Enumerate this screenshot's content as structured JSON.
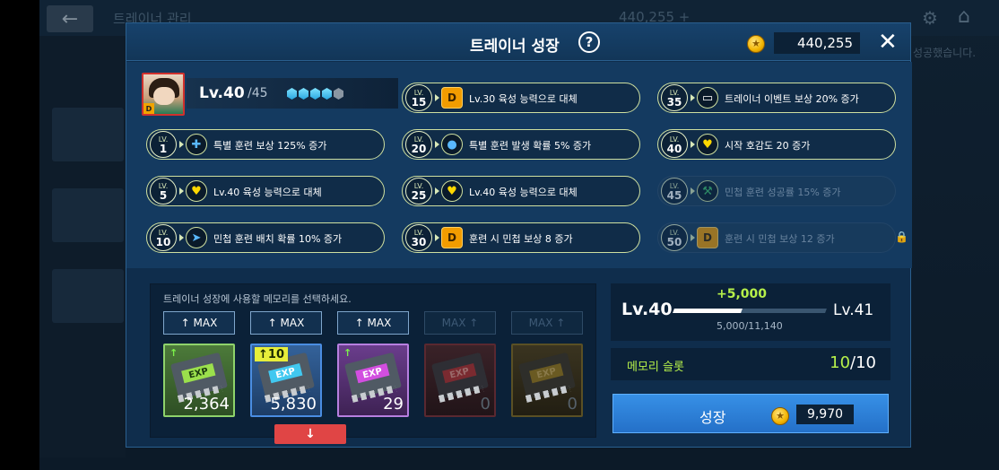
{
  "background": {
    "title": "트레이너 관리",
    "stats": "440,255 +",
    "notice": "성공했습니다."
  },
  "modal": {
    "title": "트레이너 성장",
    "gold": "440,255"
  },
  "profile": {
    "level_label": "Lv.40",
    "max_label": "/45",
    "grade_badge": "D",
    "gems_filled": 4,
    "gems_total": 5
  },
  "skills": [
    {
      "lv": "15",
      "icon": "d-grade-icon",
      "glyph": "D",
      "text": "Lv.30 육성 능력으로 대체",
      "locked": false
    },
    {
      "lv": "35",
      "icon": "chat-icon",
      "glyph": "▭",
      "text": "트레이너 이벤트 보상 20% 증가",
      "locked": false
    },
    {
      "lv": "1",
      "icon": "plus-person-icon",
      "glyph": "✚",
      "text": "특별 훈련 보상 125% 증가",
      "locked": false
    },
    {
      "lv": "20",
      "icon": "water-drop-icon",
      "glyph": "●",
      "text": "특별 훈련 발생 확률 5% 증가",
      "locked": false
    },
    {
      "lv": "40",
      "icon": "heart-icon",
      "glyph": "♥",
      "text": "시작 호감도 20 증가",
      "locked": false
    },
    {
      "lv": "5",
      "icon": "heart-icon",
      "glyph": "♥",
      "text": "Lv.40 육성 능력으로 대체",
      "locked": false
    },
    {
      "lv": "25",
      "icon": "heart-icon",
      "glyph": "♥",
      "text": "Lv.40 육성 능력으로 대체",
      "locked": false
    },
    {
      "lv": "45",
      "icon": "dumbbell-icon",
      "glyph": "⚒",
      "text": "민첩 훈련 성공률 15% 증가",
      "locked": true
    },
    {
      "lv": "10",
      "icon": "runner-icon",
      "glyph": "➤",
      "text": "민첩 훈련 배치 확률 10% 증가",
      "locked": false
    },
    {
      "lv": "30",
      "icon": "d-grade-icon",
      "glyph": "D",
      "text": "훈련 시 민첩 보상 8 증가",
      "locked": false
    },
    {
      "lv": "50",
      "icon": "d-grade-icon",
      "glyph": "D",
      "text": "훈련 시 민첩 보상 12 증가",
      "locked": true
    }
  ],
  "memory": {
    "hint": "트레이너 성장에 사용할 메모리를 선택하세요.",
    "max_buttons": [
      {
        "label": "↑ MAX",
        "enabled": true
      },
      {
        "label": "↑ MAX",
        "enabled": true
      },
      {
        "label": "↑ MAX",
        "enabled": true
      },
      {
        "label": "MAX ↑",
        "enabled": false
      },
      {
        "label": "MAX ↑",
        "enabled": false
      }
    ],
    "chips": [
      {
        "color": "green",
        "label": "EXP",
        "count": "2,364"
      },
      {
        "color": "blue",
        "label": "EXP",
        "count": "5,830",
        "selected": "↑10"
      },
      {
        "color": "purple",
        "label": "EXP",
        "count": "29"
      },
      {
        "color": "red",
        "label": "EXP",
        "count": "0"
      },
      {
        "color": "gold",
        "label": "EXP",
        "count": "0"
      }
    ],
    "down_label": "↓"
  },
  "growth": {
    "from_level": "Lv.40",
    "to_level": "Lv.41",
    "exp_gain": "+5,000",
    "exp_progress": "5,000/11,140",
    "exp_fraction": 0.449,
    "slot_label": "메모리 슬롯",
    "slot_current": "10",
    "slot_max": "/10",
    "button_label": "성장",
    "cost": "9,970"
  },
  "colors": {
    "accent_green": "#b6f04a",
    "button_blue": "#2f86de",
    "danger_red": "#e04545"
  }
}
